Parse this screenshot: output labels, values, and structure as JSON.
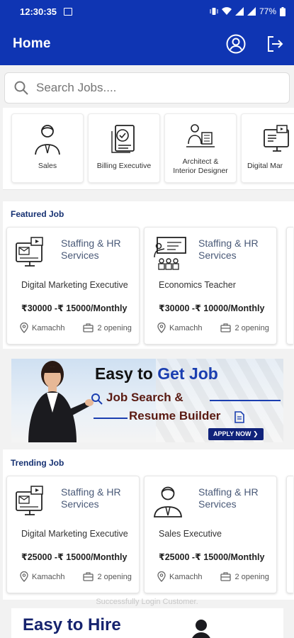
{
  "status_bar": {
    "time": "12:30:35",
    "battery": "77%"
  },
  "app_bar": {
    "title": "Home"
  },
  "search": {
    "placeholder": "Search Jobs...."
  },
  "categories": [
    {
      "label": "Sales",
      "icon": "businessman-icon"
    },
    {
      "label": "Billing Executive",
      "icon": "billing-icon"
    },
    {
      "label_line1": "Architect &",
      "label_line2": "Interior Designer",
      "icon": "architect-icon"
    },
    {
      "label": "Digital Mar",
      "icon": "digital-marketing-icon"
    }
  ],
  "featured": {
    "title": "Featured Job",
    "jobs": [
      {
        "company_line1": "Staffing & HR",
        "company_line2": "Services",
        "role": "Digital Marketing Executive",
        "salary": "₹30000 -₹ 15000/Monthly",
        "location": "Kamachh",
        "openings": "2 opening",
        "icon": "digital-marketing-icon"
      },
      {
        "company_line1": "Staffing & HR",
        "company_line2": "Services",
        "role": "Economics Teacher",
        "salary": "₹30000 -₹ 10000/Monthly",
        "location": "Kamachh",
        "openings": "2 opening",
        "icon": "teacher-icon"
      }
    ]
  },
  "banner": {
    "line1_a": "Easy to ",
    "line1_b": "Get Job",
    "line2": "Job Search &",
    "line3": "Resume Builder",
    "cta": "APPLY NOW ❯"
  },
  "trending": {
    "title": "Trending Job",
    "jobs": [
      {
        "company_line1": "Staffing & HR",
        "company_line2": "Services",
        "role": "Digital Marketing Executive",
        "salary": "₹25000 -₹ 15000/Monthly",
        "location": "Kamachh",
        "openings": "2 opening",
        "icon": "digital-marketing-icon"
      },
      {
        "company_line1": "Staffing & HR",
        "company_line2": "Services",
        "role": "Sales Executive",
        "salary": "₹25000 -₹ 15000/Monthly",
        "location": "Kamachh",
        "openings": "2 opening",
        "icon": "businessman-icon"
      }
    ]
  },
  "toast": "Successfully Login Customer.",
  "hire_banner": {
    "text": "Easy to Hire"
  },
  "colors": {
    "primary": "#0f35b3",
    "section_title": "#163172",
    "company_text": "#4a5a78"
  }
}
